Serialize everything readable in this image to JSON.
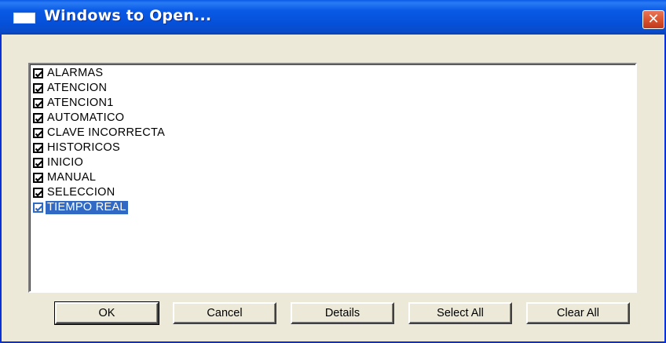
{
  "window": {
    "title": "Windows to Open...",
    "close_glyph": "✕"
  },
  "list": {
    "items": [
      {
        "label": "ALARMAS",
        "checked": true,
        "selected": false
      },
      {
        "label": "ATENCION",
        "checked": true,
        "selected": false
      },
      {
        "label": "ATENCION1",
        "checked": true,
        "selected": false
      },
      {
        "label": "AUTOMATICO",
        "checked": true,
        "selected": false
      },
      {
        "label": "CLAVE INCORRECTA",
        "checked": true,
        "selected": false
      },
      {
        "label": "HISTORICOS",
        "checked": true,
        "selected": false
      },
      {
        "label": "INICIO",
        "checked": true,
        "selected": false
      },
      {
        "label": "MANUAL",
        "checked": true,
        "selected": false
      },
      {
        "label": "SELECCION",
        "checked": true,
        "selected": false
      },
      {
        "label": "TIEMPO REAL",
        "checked": true,
        "selected": true
      }
    ]
  },
  "buttons": {
    "ok": "OK",
    "cancel": "Cancel",
    "details": "Details",
    "select_all": "Select All",
    "clear_all": "Clear All"
  },
  "colors": {
    "titlebar": "#0a5ae6",
    "close_button": "#d9542f",
    "selection": "#316ac5",
    "dialog_face": "#ece9d8"
  }
}
